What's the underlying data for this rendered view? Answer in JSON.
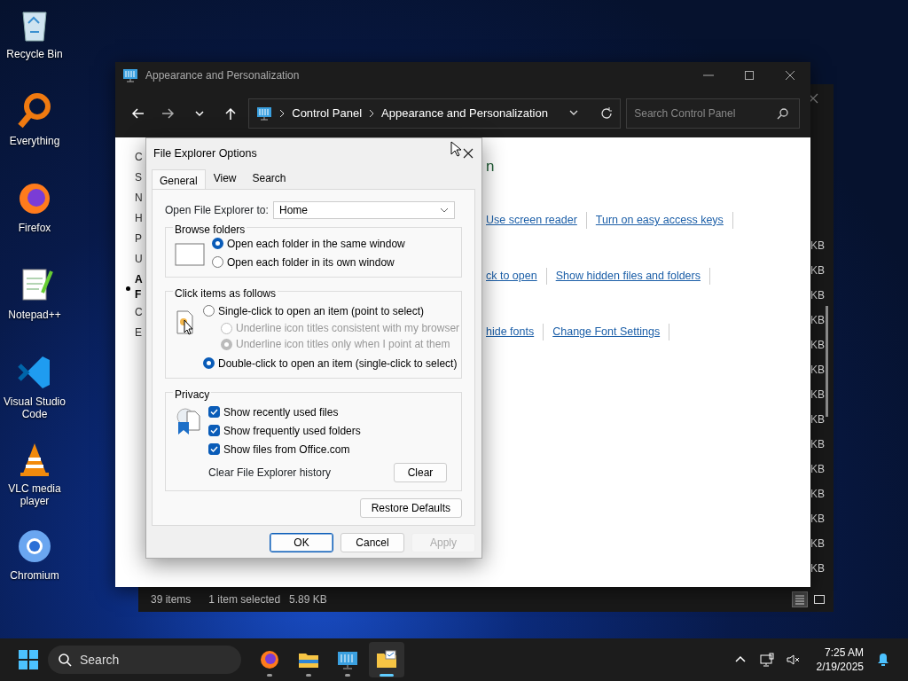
{
  "desktop_icons": [
    {
      "label": "Recycle Bin",
      "kind": "recycle"
    },
    {
      "label": "Everything",
      "kind": "magnifier"
    },
    {
      "label": "Firefox",
      "kind": "firefox"
    },
    {
      "label": "Notepad++",
      "kind": "notepad"
    },
    {
      "label": "Visual Studio Code",
      "kind": "vscode"
    },
    {
      "label": "VLC media player",
      "kind": "vlc"
    },
    {
      "label": "Chromium",
      "kind": "chromium"
    }
  ],
  "explorer_behind": {
    "size_column": [
      "KB",
      "KB",
      "KB",
      "KB",
      "KB",
      "KB",
      "KB",
      "KB",
      "KB",
      "KB",
      "KB",
      "KB",
      "KB",
      "KB"
    ],
    "status": [
      "39 items",
      "1 item selected",
      "5.89 KB"
    ],
    "views": [
      {
        "kind": "details",
        "selected": true
      },
      {
        "kind": "tiles",
        "selected": false
      }
    ]
  },
  "control_panel": {
    "title": "Appearance and Personalization",
    "breadcrumb": [
      "Control Panel",
      "Appearance and Personalization"
    ],
    "search": {
      "placeholder": "Search Control Panel"
    },
    "sidebar": [
      {
        "text": "C",
        "current": false
      },
      {
        "text": "S",
        "current": false
      },
      {
        "text": "N",
        "current": false
      },
      {
        "text": "H",
        "current": false
      },
      {
        "text": "P",
        "current": false
      },
      {
        "text": "U",
        "current": false
      },
      {
        "text": "A",
        "current": true
      },
      {
        "text": "F",
        "current": true
      },
      {
        "text": "C",
        "current": false
      },
      {
        "text": "E",
        "current": false
      }
    ],
    "heading": "n",
    "link_rows": [
      [
        "Use screen reader",
        "Turn on easy access keys"
      ],
      [
        "ck to open",
        "Show hidden files and folders"
      ],
      [
        "hide fonts",
        "Change Font Settings"
      ]
    ]
  },
  "dialog": {
    "title": "File Explorer Options",
    "tabs": [
      {
        "label": "General",
        "selected": true
      },
      {
        "label": "View",
        "selected": false
      },
      {
        "label": "Search",
        "selected": false
      }
    ],
    "open_to": {
      "label": "Open File Explorer to:",
      "value": "Home"
    },
    "browse_folders": {
      "title": "Browse folders",
      "options": [
        {
          "label": "Open each folder in the same window",
          "selected": true
        },
        {
          "label": "Open each folder in its own window",
          "selected": false
        }
      ]
    },
    "click_items": {
      "title": "Click items as follows",
      "options": [
        {
          "label": "Single-click to open an item (point to select)",
          "kind": "main",
          "selected": false,
          "disabled": false
        },
        {
          "label": "Underline icon titles consistent with my browser",
          "kind": "sub",
          "selected": false,
          "disabled": true
        },
        {
          "label": "Underline icon titles only when I point at them",
          "kind": "sub",
          "selected": true,
          "disabled": true
        },
        {
          "label": "Double-click to open an item (single-click to select)",
          "kind": "main",
          "selected": true,
          "disabled": false
        }
      ]
    },
    "privacy": {
      "title": "Privacy",
      "checkboxes": [
        {
          "label": "Show recently used files",
          "checked": true
        },
        {
          "label": "Show frequently used folders",
          "checked": true
        },
        {
          "label": "Show files from Office.com",
          "checked": true
        }
      ],
      "clear_label": "Clear File Explorer history",
      "clear_button": "Clear"
    },
    "restore_button": "Restore Defaults",
    "buttons": [
      {
        "label": "OK",
        "disabled": false,
        "default": true
      },
      {
        "label": "Cancel",
        "disabled": false,
        "default": false
      },
      {
        "label": "Apply",
        "disabled": true,
        "default": false
      }
    ]
  },
  "taskbar": {
    "search_placeholder": "Search",
    "apps": [
      {
        "kind": "firefox",
        "active": false
      },
      {
        "kind": "explorer",
        "active": false
      },
      {
        "kind": "control",
        "active": false
      },
      {
        "kind": "options",
        "active": true
      }
    ],
    "time": "7:25 AM",
    "date": "2/19/2025"
  }
}
